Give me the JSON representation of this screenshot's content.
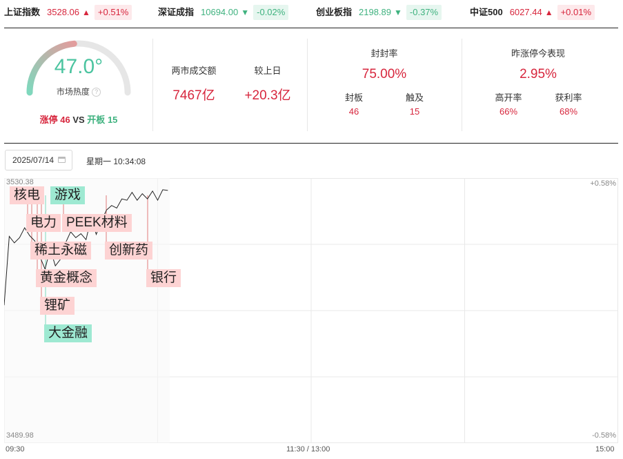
{
  "indices": [
    {
      "name": "上证指数",
      "value": "3528.06",
      "direction": "up",
      "arrow": "▲",
      "change": "+0.51%"
    },
    {
      "name": "深证成指",
      "value": "10694.00",
      "direction": "down",
      "arrow": "▼",
      "change": "-0.02%"
    },
    {
      "name": "创业板指",
      "value": "2198.89",
      "direction": "down",
      "arrow": "▼",
      "change": "-0.37%"
    },
    {
      "name": "中证500",
      "value": "6027.44",
      "direction": "up",
      "arrow": "▲",
      "change": "+0.01%"
    }
  ],
  "heat": {
    "value": "47.0°",
    "value_num": 47.0,
    "label": "市场热度",
    "help_icon": "question-circle-icon",
    "limit_up_label": "涨停",
    "limit_up_count": "46",
    "vs": "VS",
    "broken_label": "开板",
    "broken_count": "15"
  },
  "turnover": {
    "label": "两市成交额",
    "value": "7467亿",
    "vs_prev_label": "较上日",
    "vs_prev_value": "+20.3亿"
  },
  "seal_rate": {
    "label": "封封率",
    "value": "75.00%",
    "sealed_label": "封板",
    "sealed_value": "46",
    "touched_label": "触及",
    "touched_value": "15"
  },
  "yesterday": {
    "label": "昨涨停今表现",
    "value": "2.95%",
    "high_open_label": "高开率",
    "high_open_value": "66%",
    "profit_label": "获利率",
    "profit_value": "68%"
  },
  "date": {
    "value": "2025/07/14",
    "calendar_icon": "calendar-icon",
    "weekday_time": "星期一 10:34:08"
  },
  "colors": {
    "up": "#d7263d",
    "down": "#3fb27f",
    "tag_red": "#fdd3d3",
    "tag_green": "#9ee9d2"
  },
  "chart_data": {
    "type": "line",
    "y_top_label": "3530.38",
    "y_bottom_label": "3489.98",
    "pct_top_label": "+0.58%",
    "pct_bottom_label": "-0.58%",
    "ylim": [
      3489.98,
      3530.38
    ],
    "x_labels": [
      "09:30",
      "11:30 / 13:00",
      "15:00"
    ],
    "x_minutes_total": 240,
    "series": [
      {
        "x": [
          0,
          2,
          4,
          6,
          8,
          10,
          12,
          14,
          16,
          18,
          20,
          22,
          24,
          26,
          28,
          30,
          32,
          34,
          36,
          38,
          40,
          42,
          44,
          46,
          48,
          50,
          52,
          54,
          56,
          58,
          60,
          62,
          64
        ],
        "values": [
          3511.0,
          3521.5,
          3520.5,
          3521.3,
          3522.8,
          3521.6,
          3520.8,
          3518.4,
          3516.5,
          3519.6,
          3517.0,
          3518.0,
          3520.5,
          3522.2,
          3521.3,
          3521.9,
          3521.0,
          3524.3,
          3521.8,
          3523.8,
          3525.5,
          3526.2,
          3525.8,
          3527.2,
          3527.0,
          3528.2,
          3527.0,
          3528.0,
          3527.2,
          3528.4,
          3527.0,
          3528.6,
          3528.5
        ]
      }
    ],
    "event_tags": [
      {
        "text": "核电",
        "color": "red",
        "minute": 5
      },
      {
        "text": "游戏",
        "color": "green",
        "minute": 18
      },
      {
        "text": "电力",
        "color": "red",
        "minute": 10
      },
      {
        "text": "PEEK材料",
        "color": "red",
        "minute": 23
      },
      {
        "text": "稀土永磁",
        "color": "red",
        "minute": 12
      },
      {
        "text": "创新药",
        "color": "red",
        "minute": 40
      },
      {
        "text": "黄金概念",
        "color": "red",
        "minute": 14
      },
      {
        "text": "银行",
        "color": "red",
        "minute": 56
      },
      {
        "text": "锂矿",
        "color": "red",
        "minute": 16
      },
      {
        "text": "大金融",
        "color": "green",
        "minute": 16
      }
    ]
  }
}
